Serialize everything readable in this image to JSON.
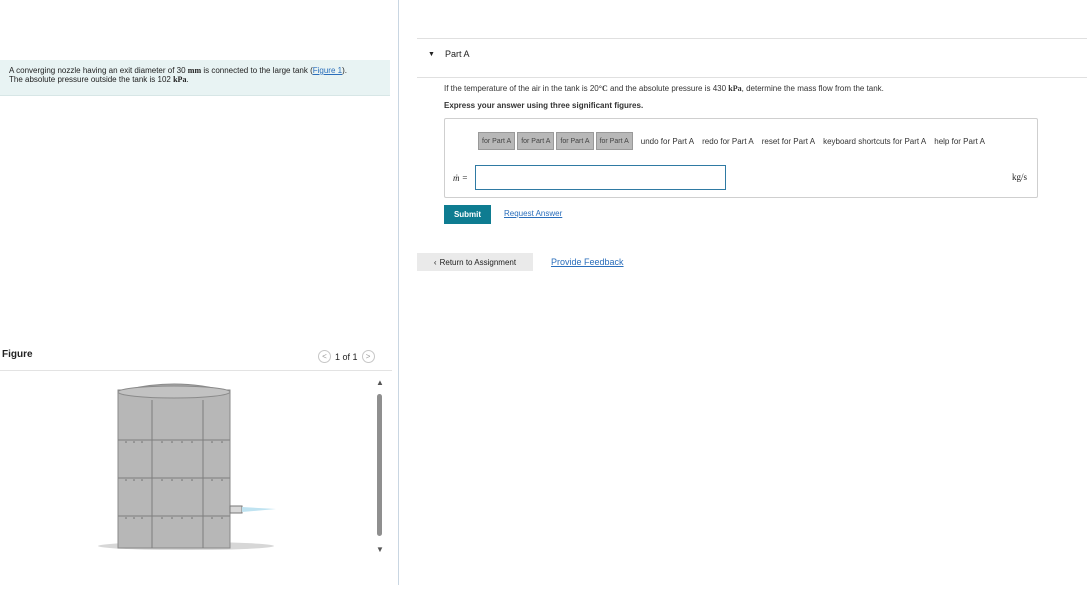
{
  "problem": {
    "line1_prefix": "A converging nozzle having an exit diameter of 30 ",
    "line1_unit": "mm",
    "line1_mid": " is connected to the large tank (",
    "figure_link": "Figure 1",
    "line1_suffix": ").",
    "line2_prefix": "The absolute pressure outside the tank is 102 ",
    "line2_unit": "kPa",
    "line2_suffix": "."
  },
  "figure": {
    "label": "Figure",
    "counter": "1 of 1",
    "prev_icon": "chevron-left-icon",
    "next_icon": "chevron-right-icon"
  },
  "part": {
    "title": "Part A",
    "question_prefix": "If the temperature of the air in the tank is 20",
    "question_temp_unit": "°C",
    "question_mid": " and the absolute pressure is 430 ",
    "question_pressure_unit": "kPa",
    "question_suffix": ", determine the mass flow from the tank.",
    "instruction": "Express your answer using three significant figures."
  },
  "toolbar": {
    "buttons": [
      "for Part A",
      "for Part A",
      "for Part A",
      "for Part A"
    ],
    "undo": "undo for Part A",
    "redo": "redo for Part A",
    "reset": "reset for Part A",
    "shortcuts": "keyboard shortcuts for Part A",
    "help": "help for Part A"
  },
  "answer": {
    "variable": "ṁ =",
    "value": "",
    "unit": "kg/s"
  },
  "actions": {
    "submit": "Submit",
    "request": "Request Answer",
    "return": "Return to Assignment",
    "feedback": "Provide Feedback"
  }
}
